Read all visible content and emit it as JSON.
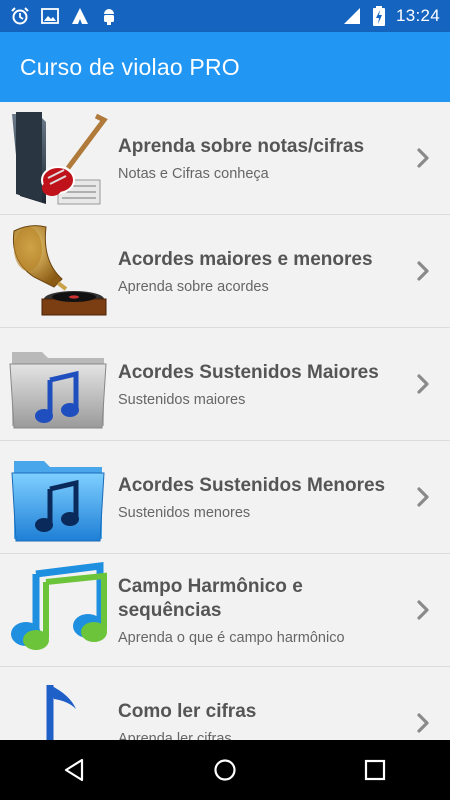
{
  "status_bar": {
    "time": "13:24",
    "left_icons": [
      "alarm-icon",
      "image-icon",
      "signal-app-icon",
      "android-debug-icon"
    ],
    "right_icons": [
      "cell-signal-icon",
      "battery-charging-icon"
    ]
  },
  "app_bar": {
    "title": "Curso de violao PRO",
    "color": "#2196f3"
  },
  "list": {
    "items": [
      {
        "title": "Aprenda sobre notas/cifras",
        "subtitle": "Notas e Cifras conheça",
        "icon": "guitar-folder-icon"
      },
      {
        "title": "Acordes maiores e menores",
        "subtitle": "Aprenda sobre acordes",
        "icon": "gramophone-icon"
      },
      {
        "title": "Acordes Sustenidos Maiores",
        "subtitle": "Sustenidos maiores",
        "icon": "gray-music-folder-icon"
      },
      {
        "title": "Acordes Sustenidos Menores",
        "subtitle": "Sustenidos menores",
        "icon": "blue-music-folder-icon"
      },
      {
        "title": "Campo Harmônico e sequências",
        "subtitle": "Aprenda o que é campo harmônico",
        "icon": "music-notes-icon"
      },
      {
        "title": "Como ler cifras",
        "subtitle": "Aprenda ler cifras",
        "icon": "blue-note-icon"
      }
    ]
  },
  "nav_bar": {
    "buttons": [
      "back-icon",
      "home-icon",
      "recents-icon"
    ]
  }
}
